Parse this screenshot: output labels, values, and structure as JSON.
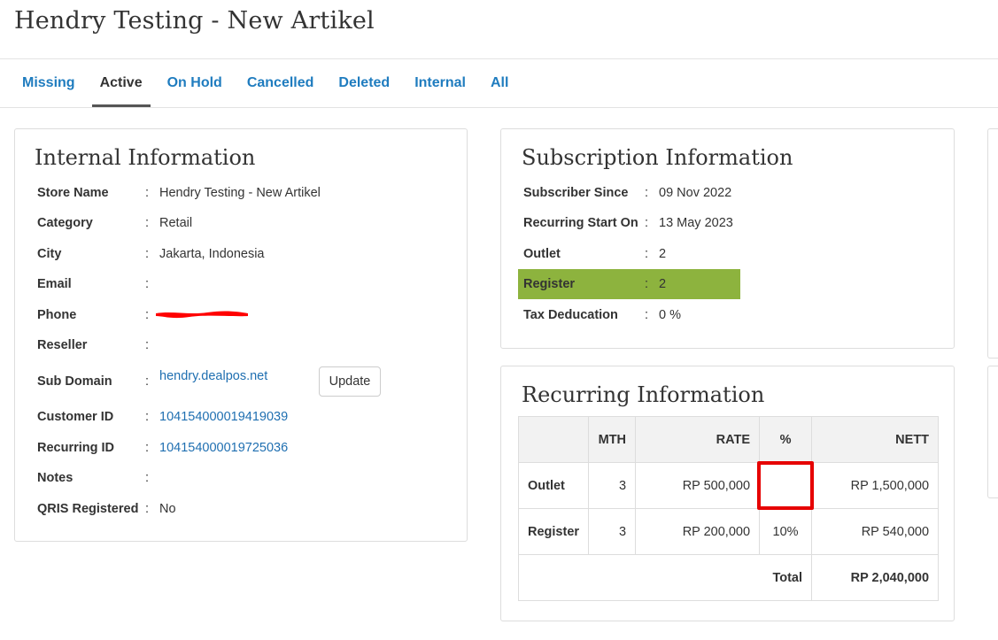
{
  "page": {
    "title": "Hendry Testing - New Artikel"
  },
  "tabs": [
    {
      "label": "Missing",
      "active": false
    },
    {
      "label": "Active",
      "active": true
    },
    {
      "label": "On Hold",
      "active": false
    },
    {
      "label": "Cancelled",
      "active": false
    },
    {
      "label": "Deleted",
      "active": false
    },
    {
      "label": "Internal",
      "active": false
    },
    {
      "label": "All",
      "active": false
    }
  ],
  "internal": {
    "title": "Internal Information",
    "rows": [
      {
        "label": "Store Name",
        "value": "Hendry Testing - New Artikel"
      },
      {
        "label": "Category",
        "value": "Retail"
      },
      {
        "label": "City",
        "value": "Jakarta, Indonesia"
      },
      {
        "label": "Email",
        "value": ""
      },
      {
        "label": "Phone",
        "value": ""
      },
      {
        "label": "Reseller",
        "value": ""
      },
      {
        "label": "Sub Domain",
        "value": "hendry.dealpos.net"
      },
      {
        "label": "Customer ID",
        "value": "104154000019419039"
      },
      {
        "label": "Recurring ID",
        "value": "104154000019725036"
      },
      {
        "label": "Notes",
        "value": ""
      },
      {
        "label": "QRIS Registered",
        "value": "No"
      }
    ],
    "colon": ":",
    "update_label": "Update"
  },
  "subscription": {
    "title": "Subscription Information",
    "rows": [
      {
        "label": "Subscriber Since",
        "value": "09 Nov 2022"
      },
      {
        "label": "Recurring Start On",
        "value": "13 May 2023"
      },
      {
        "label": "Outlet",
        "value": "2"
      },
      {
        "label": "Register",
        "value": "2"
      },
      {
        "label": "Tax Deducation",
        "value": "0 %"
      }
    ]
  },
  "recurring": {
    "title": "Recurring Information",
    "headers": [
      "",
      "MTH",
      "RATE",
      "%",
      "NETT"
    ],
    "rows": [
      {
        "label": "Outlet",
        "mth": "3",
        "rate": "RP 500,000",
        "pct": "",
        "nett": "RP 1,500,000"
      },
      {
        "label": "Register",
        "mth": "3",
        "rate": "RP 200,000",
        "pct": "10%",
        "nett": "RP 540,000"
      }
    ],
    "total_label": "Total",
    "total_value": "RP 2,040,000"
  },
  "colors": {
    "link": "#1f7cbf",
    "highlight": "#8db33e",
    "focus": "#e60000",
    "redaction": "#ff0000"
  }
}
